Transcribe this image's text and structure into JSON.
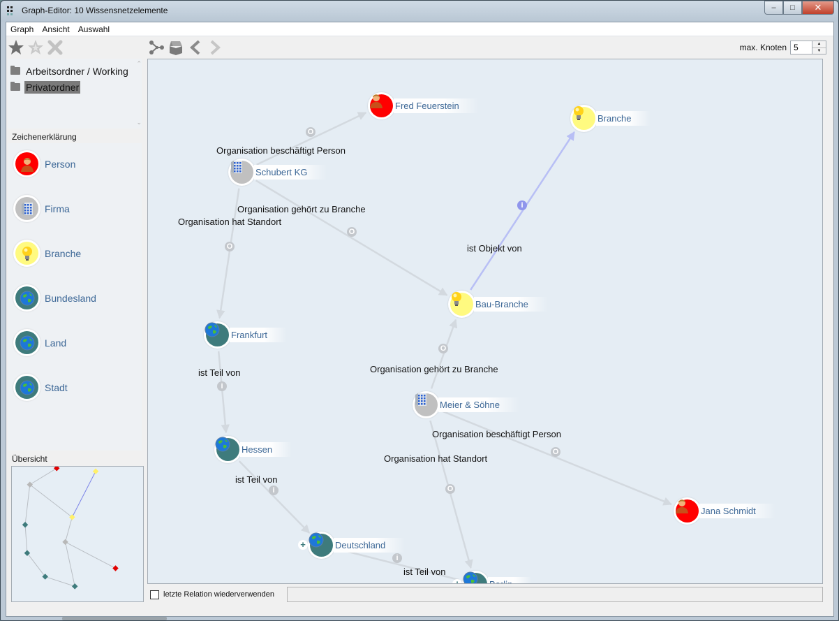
{
  "window": {
    "title": "Graph-Editor: 10 Wissensnetzelemente",
    "minimize_label": "–",
    "maximize_label": "□",
    "close_label": "✕"
  },
  "menu": [
    {
      "label": "Graph"
    },
    {
      "label": "Ansicht"
    },
    {
      "label": "Auswahl"
    }
  ],
  "toolbar_left": [
    {
      "icon": "star-filled-icon",
      "tooltip": ""
    },
    {
      "icon": "star-outline-icon",
      "tooltip": ""
    },
    {
      "icon": "close-x-icon",
      "tooltip": ""
    }
  ],
  "toolbar_right": [
    {
      "icon": "graph-branch-icon"
    },
    {
      "icon": "box-open-icon"
    },
    {
      "icon": "chevron-left-icon"
    },
    {
      "icon": "chevron-right-icon"
    }
  ],
  "max_nodes": {
    "label": "max. Knoten",
    "value": "5",
    "up_glyph": "▲",
    "down_glyph": "▼"
  },
  "folders": [
    {
      "label": "Arbeitsordner / Working",
      "selected": false
    },
    {
      "label": "Privatordner",
      "selected": true
    }
  ],
  "legend": {
    "title": "Zeichenerklärung",
    "items": [
      {
        "label": "Person",
        "type": "person",
        "color": "#ff0000"
      },
      {
        "label": "Firma",
        "type": "firma",
        "color": "#c0c0c0"
      },
      {
        "label": "Branche",
        "type": "branche",
        "color": "#fffa80"
      },
      {
        "label": "Bundesland",
        "type": "globe",
        "color": "#3e7b7c"
      },
      {
        "label": "Land",
        "type": "globe",
        "color": "#3e7b7c"
      },
      {
        "label": "Stadt",
        "type": "globe",
        "color": "#3e7b7c"
      }
    ]
  },
  "overview": {
    "title": "Übersicht"
  },
  "graph": {
    "nodes": [
      {
        "id": "fred",
        "label": "Fred Feuerstein",
        "type": "person",
        "expandable": false
      },
      {
        "id": "branche",
        "label": "Branche",
        "type": "branche",
        "expandable": false
      },
      {
        "id": "schubert",
        "label": "Schubert KG",
        "type": "firma",
        "expandable": false
      },
      {
        "id": "bau",
        "label": "Bau-Branche",
        "type": "branche",
        "expandable": false
      },
      {
        "id": "frankfurt",
        "label": "Frankfurt",
        "type": "globe",
        "expandable": false
      },
      {
        "id": "meier",
        "label": "Meier & Söhne",
        "type": "firma",
        "expandable": false
      },
      {
        "id": "hessen",
        "label": "Hessen",
        "type": "globe",
        "expandable": false
      },
      {
        "id": "jana",
        "label": "Jana Schmidt",
        "type": "person",
        "expandable": false
      },
      {
        "id": "deutschland",
        "label": "Deutschland",
        "type": "globe",
        "expandable": true
      },
      {
        "id": "berlin",
        "label": "Berlin",
        "type": "globe",
        "expandable": true
      }
    ],
    "edges": [
      {
        "from": "schubert",
        "to": "fred",
        "label": "Organisation beschäftigt Person",
        "badge": "O",
        "style": "gray"
      },
      {
        "from": "schubert",
        "to": "bau",
        "label": "Organisation gehört zu Branche",
        "badge": "O",
        "style": "gray"
      },
      {
        "from": "schubert",
        "to": "frankfurt",
        "label": "Organisation hat Standort",
        "badge": "O",
        "style": "gray"
      },
      {
        "from": "bau",
        "to": "branche",
        "label": "ist Objekt von",
        "badge": "i",
        "style": "blue"
      },
      {
        "from": "frankfurt",
        "to": "hessen",
        "label": "ist Teil von",
        "badge": "i",
        "style": "gray"
      },
      {
        "from": "meier",
        "to": "bau",
        "label": "Organisation gehört zu Branche",
        "badge": "O",
        "style": "gray"
      },
      {
        "from": "meier",
        "to": "jana",
        "label": "Organisation beschäftigt Person",
        "badge": "O",
        "style": "gray"
      },
      {
        "from": "meier",
        "to": "berlin",
        "label": "Organisation hat Standort",
        "badge": "O",
        "style": "gray"
      },
      {
        "from": "hessen",
        "to": "deutschland",
        "label": "ist Teil von",
        "badge": "i",
        "style": "gray"
      },
      {
        "from": "berlin",
        "to": "deutschland",
        "label": "ist Teil von",
        "badge": "i",
        "style": "gray"
      }
    ]
  },
  "colors": {
    "person": "#ff0000",
    "firma": "#c0c0c0",
    "branche": "#fffa80",
    "globe": "#3e7b7c",
    "edge_gray": "#d3d9df",
    "edge_blue": "#b8bff5",
    "node_label": "#3c6796"
  },
  "bottom": {
    "reuse_relation_label": "letzte Relation wiederverwenden",
    "reuse_relation_checked": false,
    "status_text": ""
  }
}
